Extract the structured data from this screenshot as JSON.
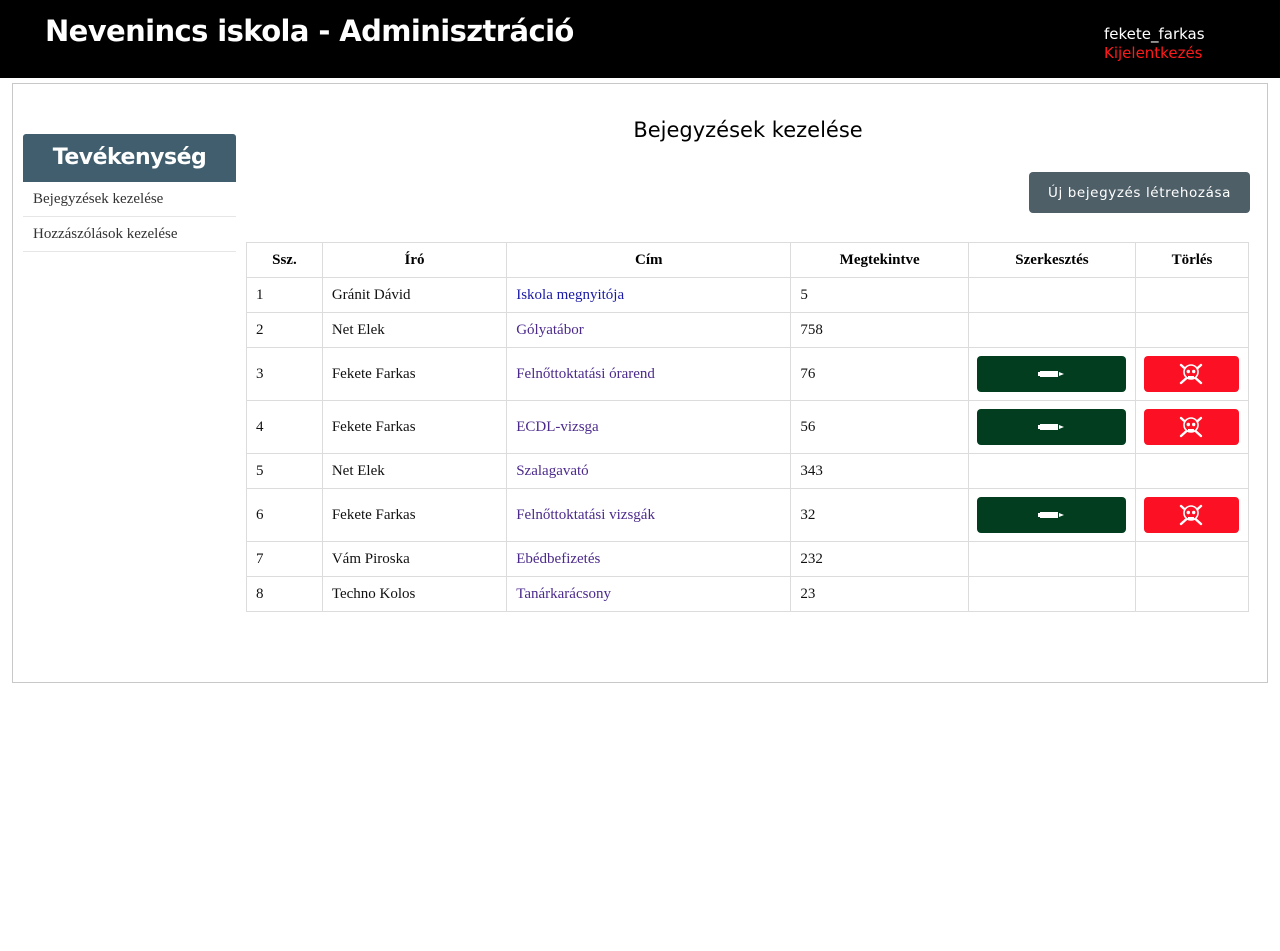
{
  "header": {
    "title": "Nevenincs iskola - Adminisztráció",
    "username": "fekete_farkas",
    "logout": "Kijelentkezés"
  },
  "sidebar": {
    "title": "Tevékenység",
    "items": [
      {
        "label": "Bejegyzések kezelése"
      },
      {
        "label": "Hozzászólások kezelése"
      }
    ]
  },
  "main": {
    "heading": "Bejegyzések kezelése",
    "new_button": "Új bejegyzés létrehozása"
  },
  "table": {
    "headers": [
      "Ssz.",
      "Író",
      "Cím",
      "Megtekintve",
      "Szerkesztés",
      "Törlés"
    ],
    "rows": [
      {
        "n": "1",
        "author": "Gránit Dávid",
        "title": "Iskola megnyitója",
        "views": "5",
        "actions": false
      },
      {
        "n": "2",
        "author": "Net Elek",
        "title": "Gólyatábor",
        "views": "758",
        "actions": false
      },
      {
        "n": "3",
        "author": "Fekete Farkas",
        "title": "Felnőttoktatási órarend",
        "views": "76",
        "actions": true
      },
      {
        "n": "4",
        "author": "Fekete Farkas",
        "title": "ECDL-vizsga",
        "views": "56",
        "actions": true
      },
      {
        "n": "5",
        "author": "Net Elek",
        "title": "Szalagavató",
        "views": "343",
        "actions": false
      },
      {
        "n": "6",
        "author": "Fekete Farkas",
        "title": "Felnőttoktatási vizsgák",
        "views": "32",
        "actions": true
      },
      {
        "n": "7",
        "author": "Vám Piroska",
        "title": "Ebédbefizetés",
        "views": "232",
        "actions": false
      },
      {
        "n": "8",
        "author": "Techno Kolos",
        "title": "Tanárkarácsony",
        "views": "23",
        "actions": false
      }
    ]
  },
  "icons": {
    "edit": "pencil-icon",
    "delete": "skull-icon"
  },
  "colors": {
    "topbar": "#000000",
    "logout": "#ff1a1a",
    "sidebar_header": "#405e6e",
    "new_button": "#4e5f67",
    "edit_button": "#023d1f",
    "delete_button": "#fc1023",
    "link": "#4b2a8c"
  }
}
